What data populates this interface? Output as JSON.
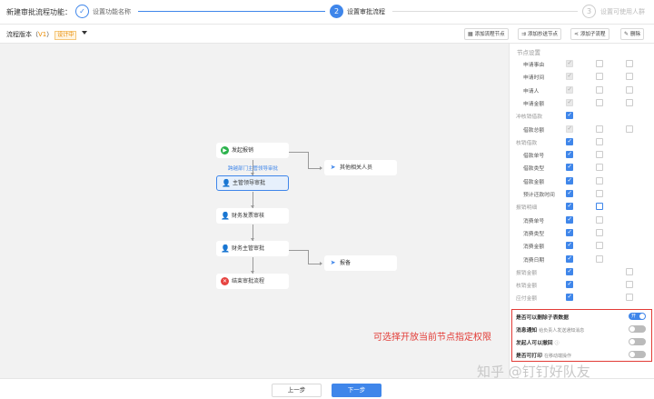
{
  "app_title": "新建审批流程功能：",
  "steps": [
    {
      "num": "✓",
      "label": "设置功能名称"
    },
    {
      "num": "2",
      "label": "设置审批流程"
    },
    {
      "num": "3",
      "label": "设置可使用人群"
    }
  ],
  "toolbar": {
    "version_prefix": "流程版本（",
    "version": "V1",
    "version_suffix": "）",
    "status_badge": "设计中",
    "buttons": [
      {
        "icon": "▦",
        "label": "添加流程节点"
      },
      {
        "icon": "⇉",
        "label": "添加抄送节点"
      },
      {
        "icon": "⋖",
        "label": "添加子流程"
      },
      {
        "icon": "✎",
        "label": "删除"
      }
    ]
  },
  "flow": {
    "nodes": [
      "发起报销",
      "主管领导审批",
      "财务发票审核",
      "财务主管审批",
      "结束审批流程"
    ],
    "cc_nodes": [
      "其他相关人员",
      "报备"
    ],
    "branch_label": "跨越部门主管领导审批"
  },
  "panel": {
    "title": "节点设置",
    "rows": [
      {
        "label": "申请事由",
        "indent": 1,
        "c": [
          "dim",
          "off",
          "off"
        ]
      },
      {
        "label": "申请时间",
        "indent": 1,
        "c": [
          "dim",
          "off",
          "off"
        ]
      },
      {
        "label": "申请人",
        "indent": 1,
        "c": [
          "dim",
          "off",
          "off"
        ]
      },
      {
        "label": "申请金额",
        "indent": 1,
        "c": [
          "dim",
          "off",
          "off"
        ]
      },
      {
        "label": "冲核销借款",
        "indent": 0,
        "c": [
          "on",
          "",
          ""
        ]
      },
      {
        "label": "借款总额",
        "indent": 1,
        "c": [
          "dim",
          "off",
          "off"
        ]
      },
      {
        "label": "核销借款",
        "indent": 0,
        "c": [
          "on",
          "off",
          ""
        ]
      },
      {
        "label": "借款单号",
        "indent": 1,
        "c": [
          "on",
          "off",
          ""
        ]
      },
      {
        "label": "借款类型",
        "indent": 1,
        "c": [
          "on",
          "off",
          ""
        ]
      },
      {
        "label": "借款金额",
        "indent": 1,
        "c": [
          "on",
          "off",
          ""
        ]
      },
      {
        "label": "预计还款时间",
        "indent": 1,
        "c": [
          "on",
          "off",
          ""
        ]
      },
      {
        "label": "报销明细",
        "indent": 0,
        "c": [
          "on",
          "blue",
          ""
        ]
      },
      {
        "label": "消费单号",
        "indent": 1,
        "c": [
          "on",
          "off",
          ""
        ]
      },
      {
        "label": "消费类型",
        "indent": 1,
        "c": [
          "on",
          "off",
          ""
        ]
      },
      {
        "label": "消费金额",
        "indent": 1,
        "c": [
          "on",
          "off",
          ""
        ]
      },
      {
        "label": "消费日期",
        "indent": 1,
        "c": [
          "on",
          "off",
          ""
        ]
      },
      {
        "label": "报销金额",
        "indent": 0,
        "c": [
          "on",
          "",
          "off"
        ]
      },
      {
        "label": "核销金额",
        "indent": 0,
        "c": [
          "on",
          "",
          "off"
        ]
      },
      {
        "label": "应付金额",
        "indent": 0,
        "c": [
          "on",
          "",
          "off"
        ]
      }
    ]
  },
  "permissions": [
    {
      "label": "是否可以删除子表数据",
      "sub": "",
      "state": "on",
      "toggle_text": "开"
    },
    {
      "label": "消息通知",
      "sub": "给负责人发送通知消息",
      "state": "off",
      "toggle_text": ""
    },
    {
      "label": "发起人可以撤回",
      "sub": "",
      "state": "off",
      "toggle_text": ""
    },
    {
      "label": "是否可打印",
      "sub": "在移动端操作",
      "state": "off",
      "toggle_text": ""
    }
  ],
  "annotation": "可选择开放当前节点指定权限",
  "watermark": "知乎 @钉钉好队友",
  "footer": {
    "prev": "上一步",
    "next": "下一步"
  }
}
